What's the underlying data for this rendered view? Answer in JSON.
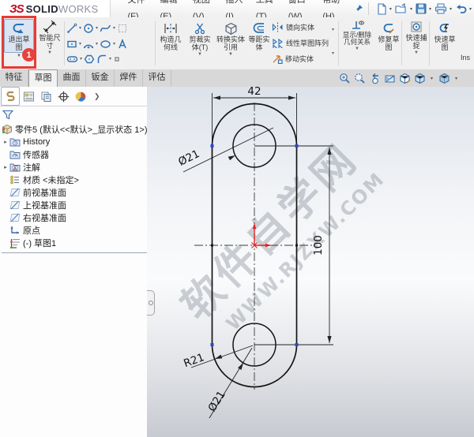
{
  "menubar": {
    "logo": {
      "mark": "ЗS",
      "solid": "SOLID",
      "works": "WORKS"
    },
    "menus": [
      "文件(F)",
      "编辑(E)",
      "视图(V)",
      "插入(I)",
      "工具(T)",
      "窗口(W)",
      "帮助(H)"
    ],
    "quick_access_icons": [
      "new-document-icon",
      "open-icon",
      "save-icon",
      "print-icon",
      "undo-icon"
    ]
  },
  "commandbar": {
    "exit_sketch": "退出草图",
    "smart_dimension": "智能尺寸",
    "construction_geometry": "构造几何线",
    "trim_entities": "剪裁实体(T)",
    "convert_entities": "转换实体引用",
    "offset_entities": "等距实体",
    "mirror_entities": "镜向实体",
    "linear_pattern": "线性草图阵列",
    "move_entities": "移动实体",
    "display_delete_relations": "显示/删除几何关系",
    "repair_sketch": "修复草图",
    "quick_snaps": "快速捕捉",
    "rapid_sketch": "快速草图",
    "truncated_label": "Ins",
    "sketch_tool_icons": [
      "line-tool-icon",
      "circle-tool-icon",
      "spline-tool-icon",
      "grid-plane-icon",
      "rectangle-tool-icon",
      "arc-tool-icon",
      "ellipse-tool-icon",
      "text-tool-icon",
      "slot-tool-icon",
      "polygon-tool-icon",
      "fillet-tool-icon",
      "point-tool-icon"
    ]
  },
  "tabs": {
    "items": [
      "特征",
      "草图",
      "曲面",
      "钣金",
      "焊件",
      "评估"
    ],
    "active": "草图"
  },
  "view_toolbar_icons": [
    "zoom-fit-icon",
    "zoom-area-icon",
    "previous-view-icon",
    "section-view-icon",
    "display-style-icon",
    "view-orientation-icon",
    "shaded-view-icon"
  ],
  "feature_tree": {
    "tab_icons": [
      "featuremanager-tab-icon",
      "propertymanager-tab-icon",
      "configmanager-tab-icon",
      "dimxpert-tab-icon",
      "displaymanager-tab-icon"
    ],
    "root": "零件5 (默认<<默认>_显示状态 1>)",
    "items": [
      "History",
      "传感器",
      "注解",
      "材质 <未指定>",
      "前视基准面",
      "上视基准面",
      "右视基准面",
      "原点",
      "(-) 草图1"
    ]
  },
  "annotation": {
    "step": "1"
  },
  "sketch": {
    "dimensions": {
      "width": "42",
      "top_diameter": "Ø21",
      "length": "100",
      "radius": "R21",
      "bottom_diameter": "Ø21"
    },
    "watermark": {
      "line1": "软件自学网",
      "line2": "WWW.RJZXW.COM"
    }
  },
  "colors": {
    "accent_blue": "#2a72b5",
    "annotation_red": "#e63c34",
    "point_blue": "#2945d8",
    "origin_red": "#e02020"
  }
}
